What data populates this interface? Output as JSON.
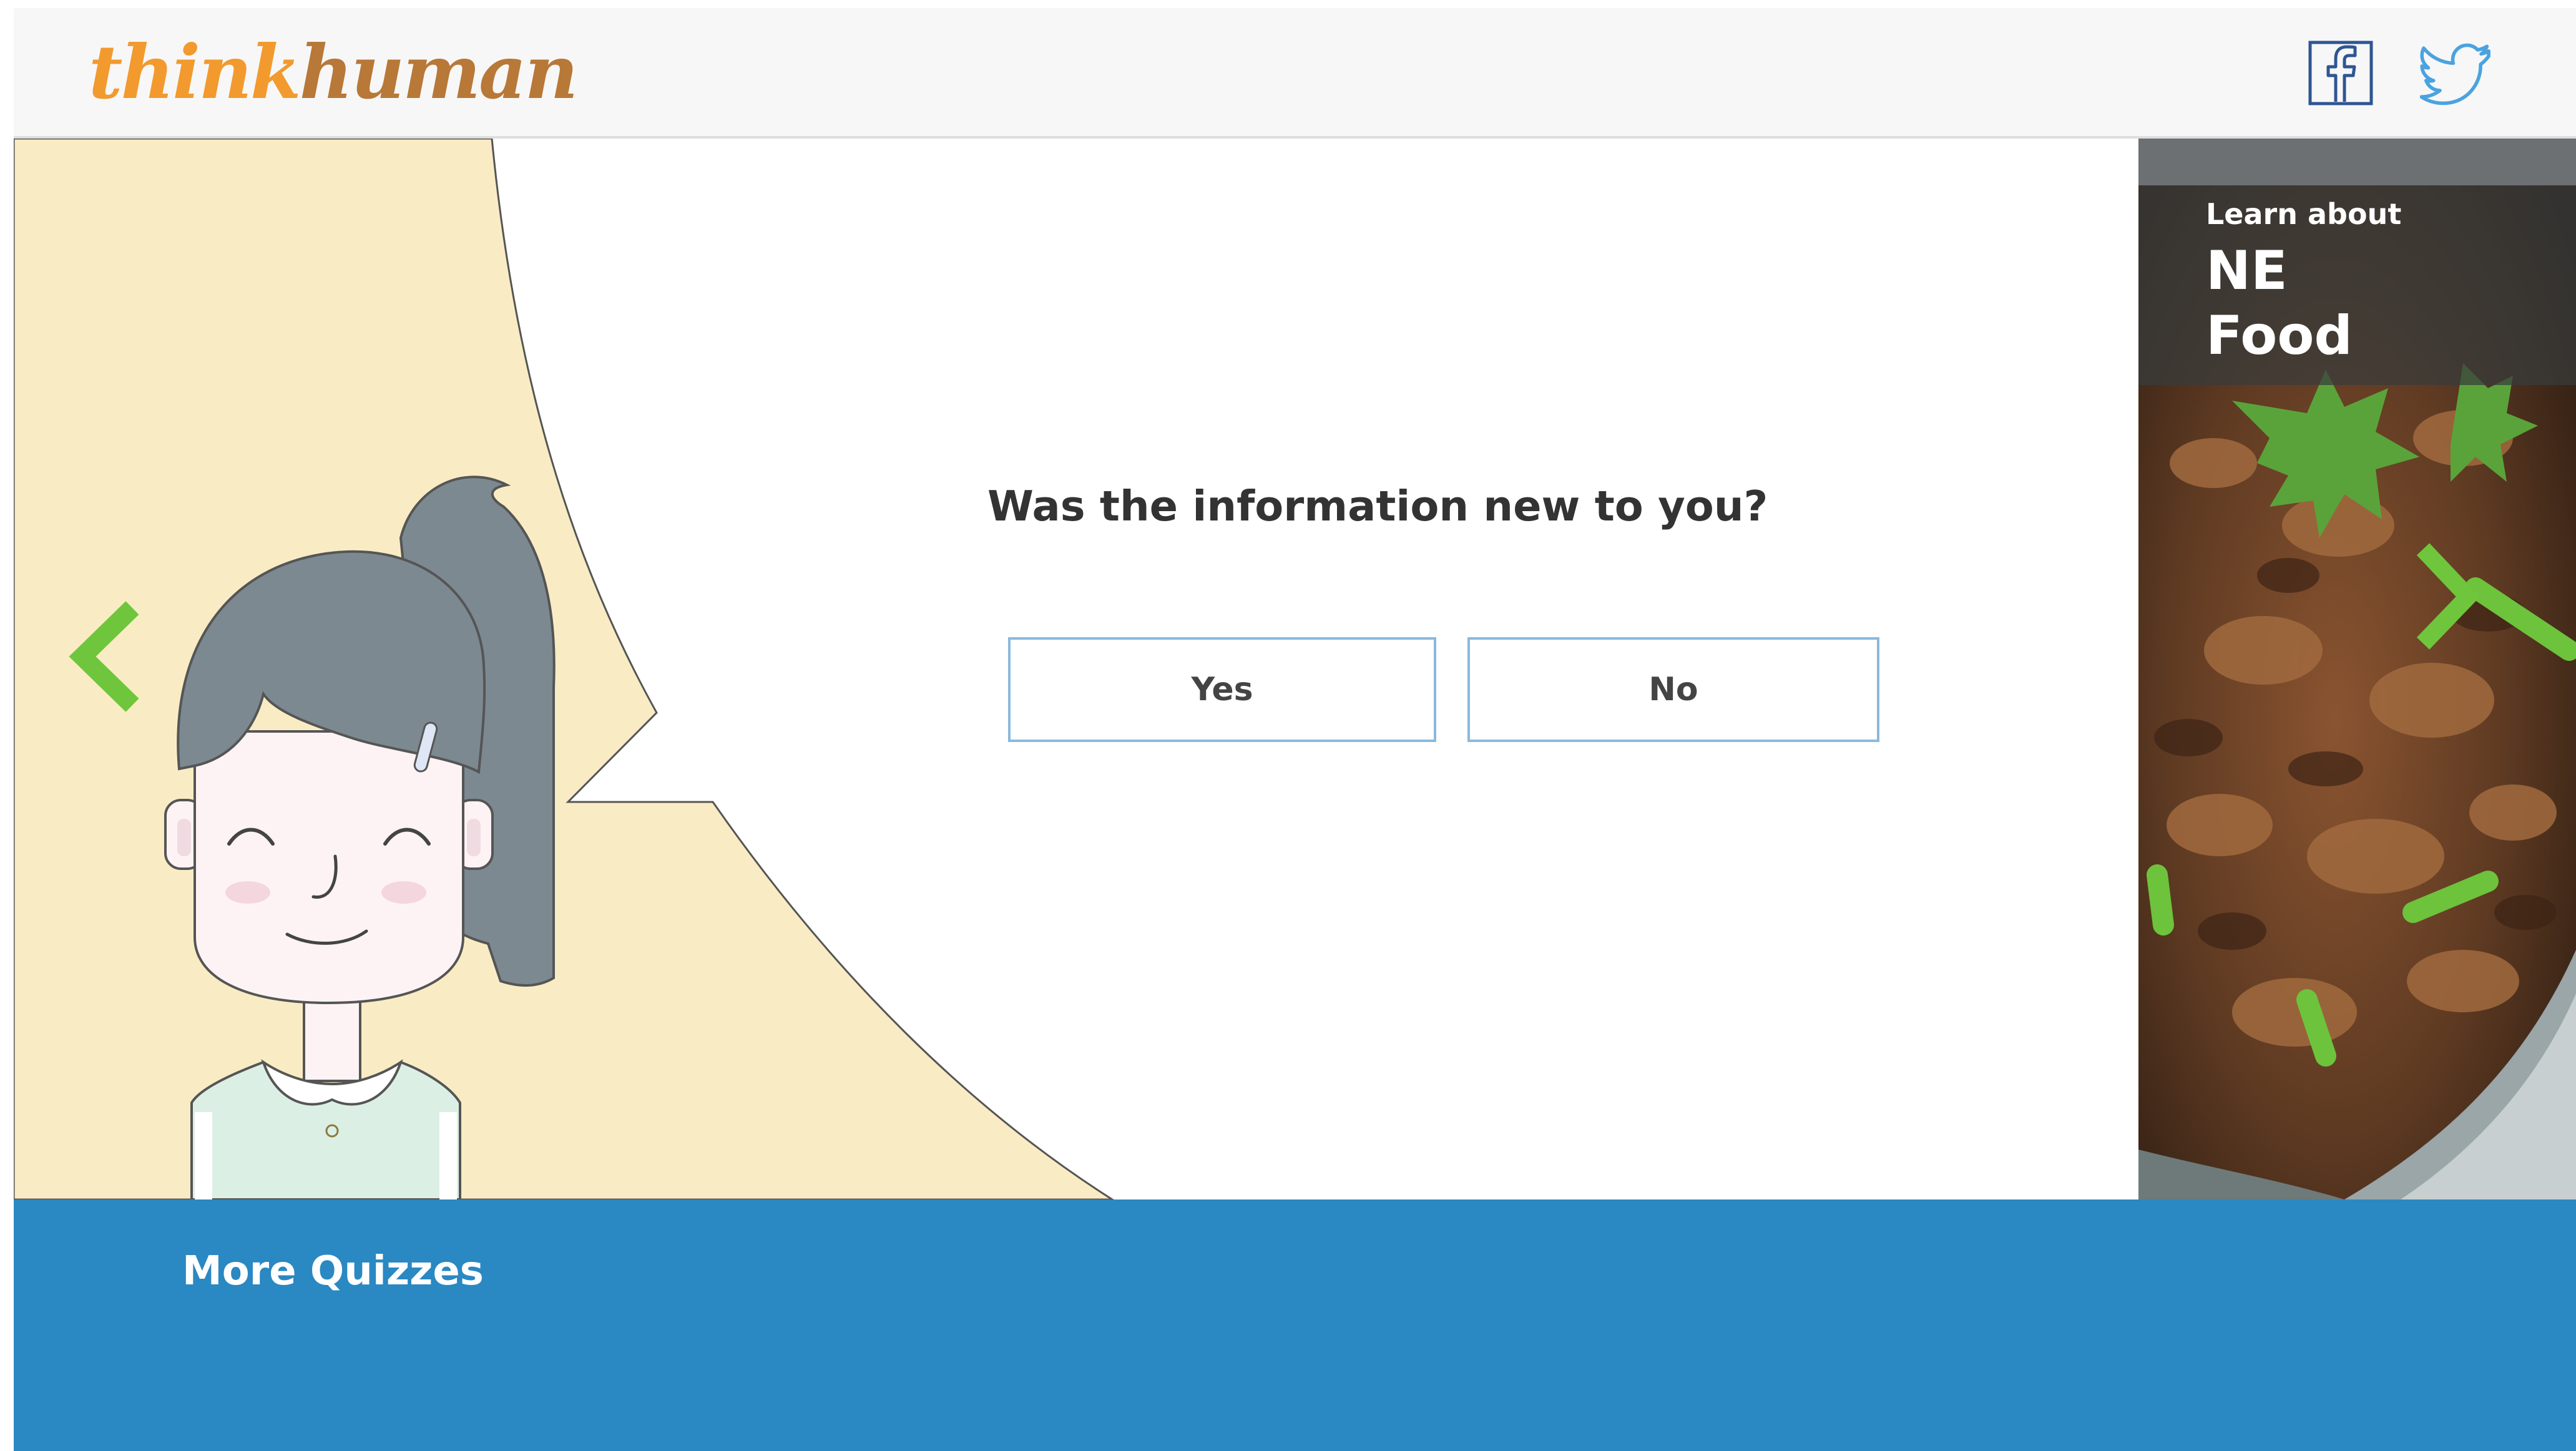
{
  "header": {
    "logo_first": "think",
    "logo_second": "human",
    "share_icons": [
      "facebook-icon",
      "twitter-icon"
    ]
  },
  "quiz": {
    "question": "Was the information new to you?",
    "yes_label": "Yes",
    "no_label": "No"
  },
  "side_panel": {
    "kicker": "Learn about",
    "title_line1": "NE",
    "title_line2": "Food"
  },
  "footer": {
    "more_label": "More Quizzes"
  },
  "colors": {
    "logo_orange": "#f29a2e",
    "logo_brown": "#b87838",
    "arrow_green": "#6fc63c",
    "bubble_cream": "#f9ecc4",
    "footer_blue": "#2a88c2",
    "button_border": "#8ab9dd",
    "social_blue": "#2f5592",
    "twitter_blue": "#4aa3df"
  }
}
